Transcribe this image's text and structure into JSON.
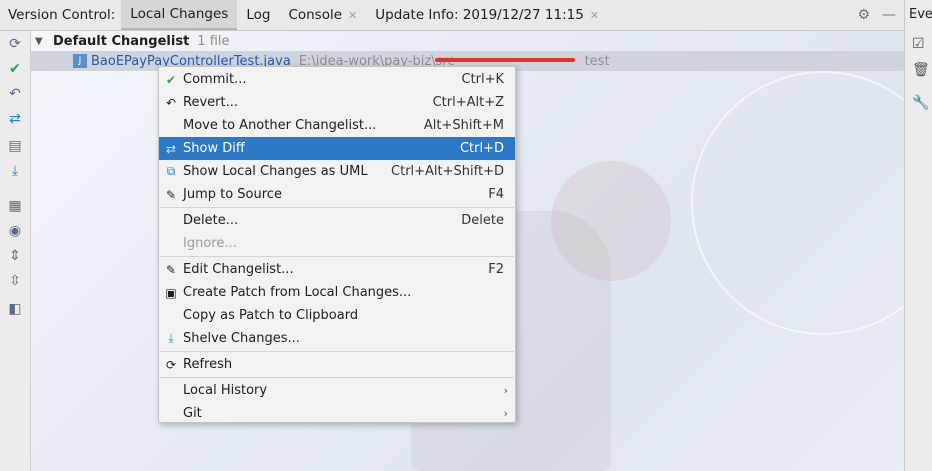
{
  "tabbar": {
    "label": "Version Control:",
    "tabs": [
      {
        "label": "Local Changes",
        "closable": false,
        "active": true
      },
      {
        "label": "Log",
        "closable": false,
        "active": false
      },
      {
        "label": "Console",
        "closable": true,
        "active": false
      },
      {
        "label": "Update Info: 2019/12/27 11:15",
        "closable": true,
        "active": false
      }
    ]
  },
  "right_panel": {
    "label": "Ever"
  },
  "changelist": {
    "name": "Default Changelist",
    "count": "1 file"
  },
  "file": {
    "name": "BaoEPayPayControllerTest.java",
    "path": "E:\\idea-work\\pay-biz\\src",
    "path_tail": "test"
  },
  "menu": {
    "items": [
      {
        "label": "Commit...",
        "shortcut": "Ctrl+K",
        "icon": "check-icon"
      },
      {
        "label": "Revert...",
        "shortcut": "Ctrl+Alt+Z",
        "icon": "revert-icon"
      },
      {
        "label": "Move to Another Changelist...",
        "shortcut": "Alt+Shift+M",
        "icon": ""
      },
      {
        "label": "Show Diff",
        "shortcut": "Ctrl+D",
        "icon": "diff-icon",
        "selected": true
      },
      {
        "label": "Show Local Changes as UML",
        "shortcut": "Ctrl+Alt+Shift+D",
        "icon": "uml-icon"
      },
      {
        "label": "Jump to Source",
        "shortcut": "F4",
        "icon": "edit-icon"
      },
      {
        "label": "Delete...",
        "shortcut": "Delete",
        "icon": ""
      },
      {
        "label": "Ignore...",
        "shortcut": "",
        "icon": "",
        "disabled": true
      },
      {
        "label": "Edit Changelist...",
        "shortcut": "F2",
        "icon": "pencil-icon"
      },
      {
        "label": "Create Patch from Local Changes...",
        "shortcut": "",
        "icon": "patch-icon"
      },
      {
        "label": "Copy as Patch to Clipboard",
        "shortcut": "",
        "icon": ""
      },
      {
        "label": "Shelve Changes...",
        "shortcut": "",
        "icon": "shelve-icon"
      },
      {
        "label": "Refresh",
        "shortcut": "",
        "icon": "refresh-icon"
      },
      {
        "label": "Local History",
        "shortcut": "",
        "icon": "",
        "submenu": true
      },
      {
        "label": "Git",
        "shortcut": "",
        "icon": "",
        "submenu": true
      }
    ]
  },
  "colors": {
    "selection": "#2b79c6",
    "file_name": "#2a55b0",
    "annotation_stroke": "#e3332e"
  }
}
